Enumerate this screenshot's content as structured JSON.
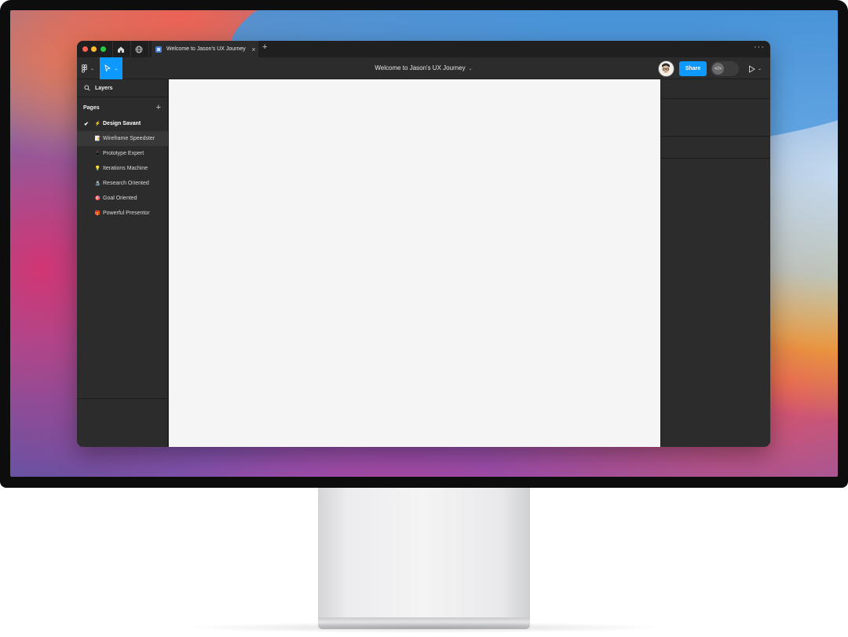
{
  "app": {
    "tab_title": "Welcome to Jason's UX Journey",
    "doc_title": "Welcome to Jason's UX Journey"
  },
  "toolbar": {
    "share_label": "Share",
    "dev_mode_icon": "</>"
  },
  "left_panel": {
    "layers_label": "Layers",
    "pages_label": "Pages",
    "pages": [
      {
        "emoji": "⚡",
        "label": "Design Savant",
        "selected": true
      },
      {
        "emoji": "📝",
        "label": "Wireframe Speedster",
        "selected": false
      },
      {
        "emoji": "📱",
        "label": "Prototype Expert",
        "selected": false
      },
      {
        "emoji": "💡",
        "label": "Iterations Machine",
        "selected": false
      },
      {
        "emoji": "🔬",
        "label": "Research Oriented",
        "selected": false
      },
      {
        "emoji": "🎯",
        "label": "Goal Oriented",
        "selected": false
      },
      {
        "emoji": "🎁",
        "label": "Powerful Presentor",
        "selected": false
      }
    ]
  },
  "colors": {
    "accent": "#0d99ff",
    "panel": "#2c2c2c",
    "canvas": "#f5f5f5"
  }
}
